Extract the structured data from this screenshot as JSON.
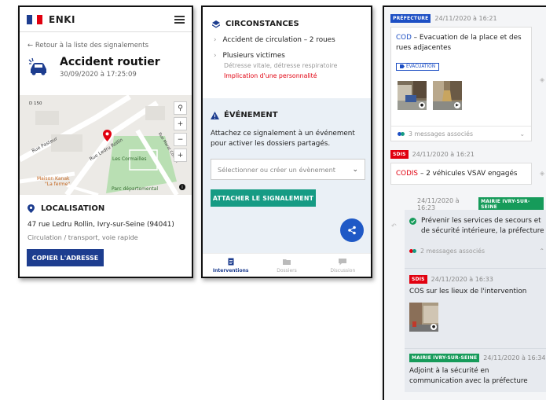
{
  "screen1": {
    "app_name": "ENKI",
    "back_link": "← Retour à la liste des signalements",
    "title": "Accident routier",
    "datetime": "30/09/2020 à 17:25:09",
    "map_labels": {
      "rue_pasteur": "Rue Pasteur",
      "rue_ledru": "Rue Ledru Rollin",
      "cormailles": "Les Cormailles",
      "maison": "Maison Kanak",
      "la_ferme": "\"La ferme\"",
      "parc": "Parc départemental",
      "rue_marat": "Rue Marat Colline",
      "d150": "D 150"
    },
    "location_heading": "LOCALISATION",
    "address": "47 rue Ledru Rollin, Ivry-sur-Seine (94041)",
    "category": "Circulation / transport, voie rapide",
    "copy_button": "COPIER L'ADRESSE",
    "colors": {
      "navy": "#1d3d8f",
      "red": "#e1000f"
    }
  },
  "screen2": {
    "circumstances_heading": "CIRCONSTANCES",
    "items": [
      {
        "label": "Accident de circulation – 2 roues"
      },
      {
        "label": "Plusieurs victimes"
      }
    ],
    "sub_detail": "Détresse vitale, détresse respiratoire",
    "sub_alert": "Implication d'une personnalité",
    "event_heading": "ÉVÉNEMENT",
    "event_text": "Attachez ce signalement à un événement pour activer les dossiers partagés.",
    "select_placeholder": "Sélectionner ou créer un évènement",
    "attach_button": "ATTACHER LE SIGNALEMENT",
    "tabs": [
      {
        "label": "Interventions",
        "active": true,
        "icon": "document-icon"
      },
      {
        "label": "Dossiers",
        "active": false,
        "icon": "folder-icon"
      },
      {
        "label": "Discussion",
        "active": false,
        "icon": "chat-icon"
      }
    ]
  },
  "screen3": {
    "msg1": {
      "badge": "PRÉFECTURE",
      "date": "24/11/2020 à 16:21",
      "code": "COD",
      "text": "– Evacuation de la place et des rues adjacentes",
      "tag": "ÉVACUATION",
      "assoc": "3 messages associés"
    },
    "msg2": {
      "badge": "SDIS",
      "date": "24/11/2020 à 16:21",
      "code": "CODIS",
      "text": "– 2 véhicules VSAV engagés"
    },
    "msg3": {
      "date": "24/11/2020 à 16:23",
      "badge": "MAIRIE IVRY-SUR-SEINE",
      "text": "Prévenir les services de secours et de sécurité intérieure, la préfecture",
      "assoc": "2 messages associés"
    },
    "msg4": {
      "badge": "SDIS",
      "date": "24/11/2020 à 16:33",
      "text": "COS sur les lieux de l'intervention"
    },
    "msg5": {
      "badge": "MAIRIE IVRY-SUR-SEINE",
      "date": "24/11/2020 à 16:34",
      "text": "Adjoint à la sécurité en communication avec la préfecture"
    }
  }
}
